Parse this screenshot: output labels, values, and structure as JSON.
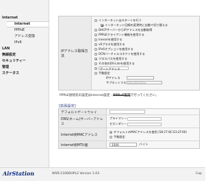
{
  "sidebar": {
    "items": [
      {
        "label": "Internet",
        "level": "top"
      },
      {
        "label": "Internet",
        "level": "sub",
        "selected": true
      },
      {
        "label": "PPPoE",
        "level": "sub"
      },
      {
        "label": "アドレス変換",
        "level": "sub"
      },
      {
        "label": "IPv6",
        "level": "sub"
      },
      {
        "label": "LAN",
        "level": "top"
      },
      {
        "label": "無線設定",
        "level": "top"
      },
      {
        "label": "セキュリティー",
        "level": "top"
      },
      {
        "label": "管理",
        "level": "top"
      },
      {
        "label": "ステータス",
        "level": "top"
      }
    ]
  },
  "ip_method": {
    "label": "IPアドレス取得方法",
    "options": [
      {
        "type": "radio",
        "label": "インターネット@スタートを行う",
        "checked": false
      },
      {
        "type": "checkbox",
        "label": "インターネット回線の変更時に自動で切り替える",
        "checked": true,
        "indent": true
      },
      {
        "type": "radio",
        "label": "DHCPサーバーからIPアドレスを自動取得",
        "checked": false
      },
      {
        "type": "radio",
        "label": "PPPoEクライアント機能を使用する",
        "checked": false
      },
      {
        "type": "radio",
        "label": "Inexseを使用する",
        "checked": false
      },
      {
        "type": "radio",
        "label": "v6プラスを使用する",
        "checked": false
      },
      {
        "type": "radio",
        "label": "IPv6オプションを使用する",
        "checked": false
      },
      {
        "type": "radio",
        "label": "OCNバーチャルコネクトを使用する",
        "checked": false
      },
      {
        "type": "radio",
        "label": "クロスパスを使用する",
        "checked": true
      },
      {
        "type": "radio",
        "label": "その他のDS-Liteを使用する",
        "checked": false
      },
      {
        "type": "radio",
        "label": "ゲートアドレス",
        "checked": false,
        "input": true
      },
      {
        "type": "radio",
        "label": "手動設定",
        "checked": false
      }
    ],
    "ip_label": "IPアドレス",
    "subnet_label": "サブネットマスク",
    "subnet_value": "255.255.255.0"
  },
  "note": {
    "prefix": "PPPoE接続先の設定はInternet設定 - ",
    "link": "PPPoE設定",
    "suffix": "で行ってください。"
  },
  "advanced": {
    "title": "[拡張設定]",
    "default_gateway_label": "デフォルトゲートウェイ",
    "dns_label": "DNS(ネーム)サーバーアドレス",
    "primary_label": "プライマリー",
    "secondary_label": "セカンダリー",
    "mac_label": "Internet側MACアドレス",
    "mac_default": "デフォルトのMACアドレスを使用 (58:27:8C:E3:2F:60)",
    "mac_manual": "手動設定",
    "mtu_label": "Internet側MTU値",
    "mtu_value": "1500",
    "mtu_unit": "バイト"
  },
  "footer": {
    "logo": "AirStation",
    "version": "WSR-1166DHPL2 Version 1.03",
    "copyright": "Cop"
  },
  "colors": {
    "sidebar_bg": "#f2f2f2",
    "panel_bg": "#f5f5f5",
    "label_bg": "#ebebeb",
    "brand": "#0a2a80",
    "section_title": "#2a3a7a"
  }
}
